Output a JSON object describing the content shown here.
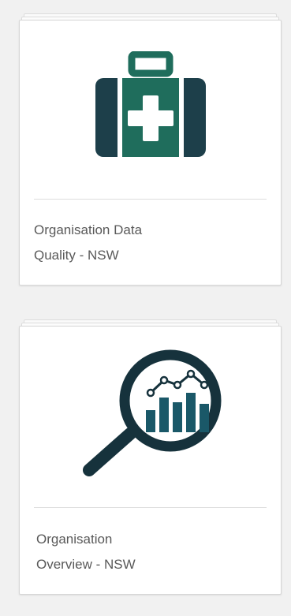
{
  "cards": [
    {
      "title_line1": "Organisation Data",
      "title_line2": "Quality - NSW",
      "icon": "first-aid-kit-icon"
    },
    {
      "title_line1": "Organisation",
      "title_line2": "Overview - NSW",
      "icon": "magnifier-chart-icon"
    }
  ],
  "colors": {
    "kit_dark": "#1d3f4a",
    "kit_green": "#1f6d5c",
    "magnifier_dark": "#16323c",
    "bars": "#1a5868",
    "card_text": "#595959",
    "background": "#f1f1f1"
  }
}
